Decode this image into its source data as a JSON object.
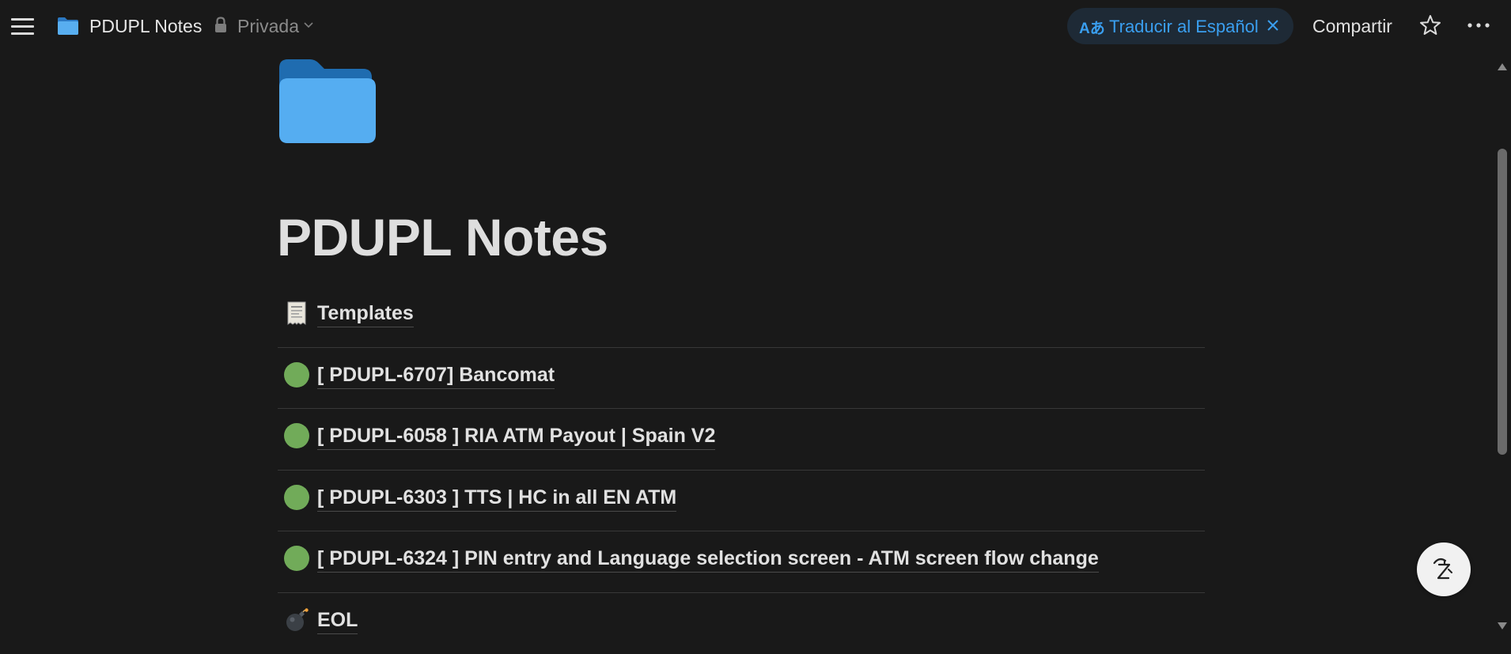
{
  "topbar": {
    "menu_icon": "hamburger-menu-icon",
    "breadcrumb_icon": "folder-icon",
    "breadcrumb_title": "PDUPL Notes",
    "privacy_icon": "lock-icon",
    "privacy_label": "Privada",
    "translate_icon_text": "Aあ",
    "translate_label": "Traducir al Español",
    "translate_color": "#3a9ff0",
    "share_label": "Compartir",
    "favorite_icon": "star-icon",
    "more_icon": "more-horizontal-icon"
  },
  "page": {
    "icon": "folder-icon",
    "title": "PDUPL Notes",
    "items": [
      {
        "icon": "receipt-icon",
        "label": "Templates"
      },
      {
        "icon": "green-circle-icon",
        "label": "[ PDUPL-6707] Bancomat"
      },
      {
        "icon": "green-circle-icon",
        "label": "[ PDUPL-6058 ] RIA ATM Payout | Spain V2"
      },
      {
        "icon": "green-circle-icon",
        "label": "[ PDUPL-6303 ] TTS | HC in all EN ATM"
      },
      {
        "icon": "green-circle-icon",
        "label": "[ PDUPL-6324 ] PIN entry and Language selection screen - ATM screen flow change"
      },
      {
        "icon": "bomb-icon",
        "label": "EOL"
      }
    ],
    "status_color": "#71ab59"
  },
  "floating": {
    "ai_icon": "notion-ai-face-icon"
  }
}
